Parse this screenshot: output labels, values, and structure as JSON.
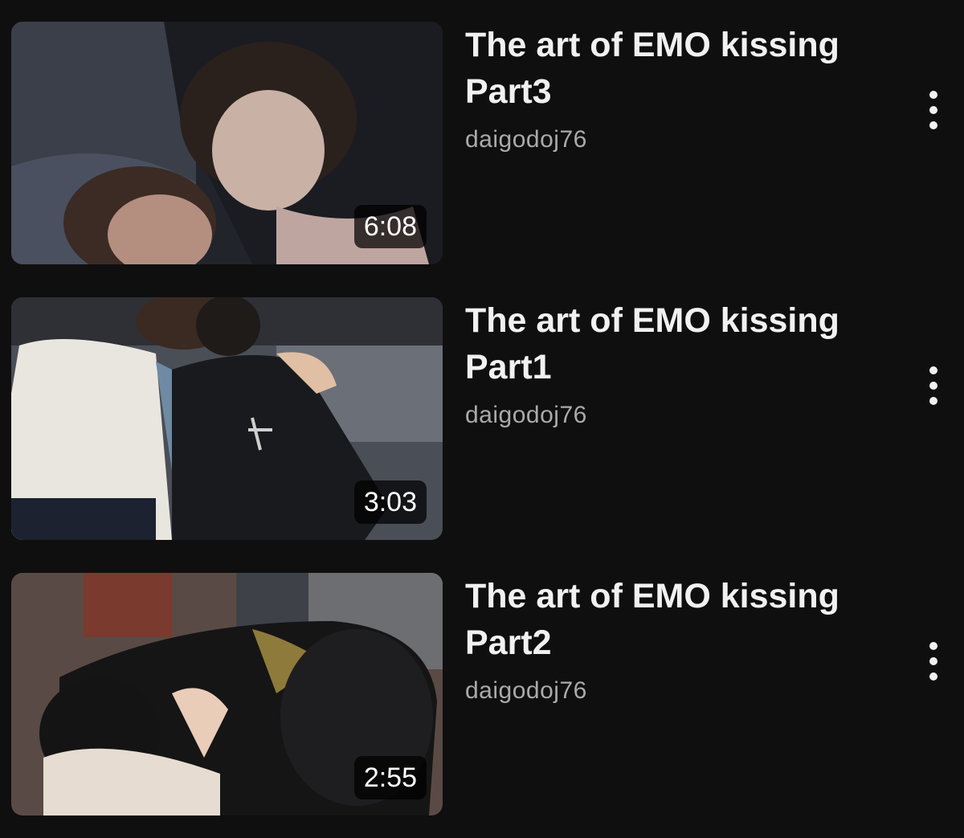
{
  "videos": [
    {
      "title_line1": "The art of EMO kissing",
      "title_line2": "Part3",
      "channel": "daigodoj76",
      "duration": "6:08",
      "thumbnail_palette": [
        "#3a3f4a",
        "#1b1c22",
        "#c9b1a6",
        "#2a201c"
      ],
      "menu_icon": "more-vert-icon"
    },
    {
      "title_line1": "The art of EMO kissing",
      "title_line2": "Part1",
      "channel": "daigodoj76",
      "duration": "3:03",
      "thumbnail_palette": [
        "#4a4e56",
        "#e9e6df",
        "#191a1d",
        "#6f8aa3"
      ],
      "menu_icon": "more-vert-icon"
    },
    {
      "title_line1": "The art of EMO kissing",
      "title_line2": "Part2",
      "channel": "daigodoj76",
      "duration": "2:55",
      "thumbnail_palette": [
        "#5a4a45",
        "#151515",
        "#e7dcd2",
        "#8e7a3a"
      ],
      "menu_icon": "more-vert-icon"
    }
  ]
}
